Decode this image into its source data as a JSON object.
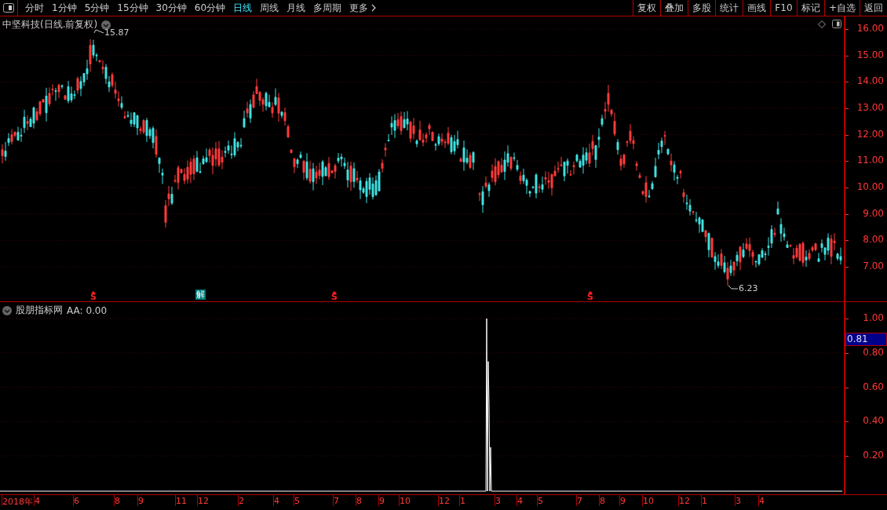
{
  "toolbar": {
    "periods": [
      {
        "label": "分时",
        "selected": false
      },
      {
        "label": "1分钟",
        "selected": false
      },
      {
        "label": "5分钟",
        "selected": false
      },
      {
        "label": "15分钟",
        "selected": false
      },
      {
        "label": "30分钟",
        "selected": false
      },
      {
        "label": "60分钟",
        "selected": false
      },
      {
        "label": "日线",
        "selected": true
      },
      {
        "label": "周线",
        "selected": false
      },
      {
        "label": "月线",
        "selected": false
      },
      {
        "label": "多周期",
        "selected": false
      }
    ],
    "more": "更多",
    "actions": [
      "复权",
      "叠加",
      "多股",
      "统计",
      "画线",
      "F10",
      "标记",
      "+自选",
      "返回"
    ]
  },
  "price_panel": {
    "title": "中坚科技(日线.前复权)",
    "high_label": "15.87",
    "low_label": "6.23",
    "axis_labels": [
      "16.00",
      "15.00",
      "14.00",
      "13.00",
      "12.00",
      "11.00",
      "10.00",
      "9.00",
      "8.00",
      "7.00"
    ],
    "markers": [
      {
        "kind": "signal",
        "text": "S"
      },
      {
        "kind": "badge",
        "text": "解"
      },
      {
        "kind": "signal",
        "text": "S"
      },
      {
        "kind": "signal",
        "text": "S"
      }
    ]
  },
  "indicator_panel": {
    "title": "股朋指标网",
    "reading": "AA: 0.00",
    "axis_labels": [
      "1.00",
      "0.80",
      "0.60",
      "0.40",
      "0.20"
    ],
    "cursor_value": "0.81"
  },
  "time_axis": {
    "labels": [
      "2018年",
      "4",
      "6",
      "8",
      "9",
      "11",
      "12",
      "2",
      "4",
      "5",
      "7",
      "8",
      "9",
      "10",
      "12",
      "1",
      "3",
      "4",
      "5",
      "7",
      "8",
      "9",
      "10",
      "12",
      "1",
      "3",
      "4"
    ]
  }
}
